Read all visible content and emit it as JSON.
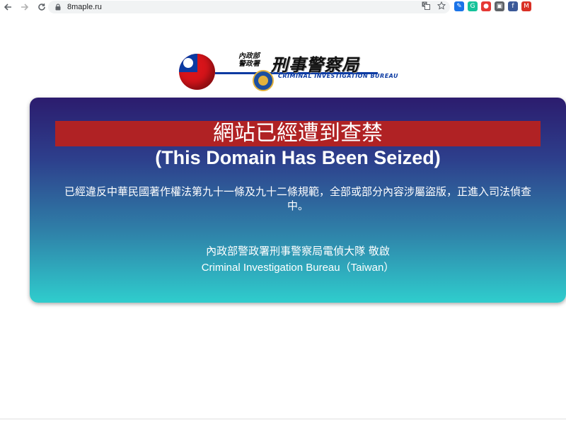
{
  "browser": {
    "url": "8maple.ru",
    "back_icon": "arrow-left-icon",
    "forward_icon": "arrow-right-icon",
    "reload_icon": "reload-icon",
    "lock_icon": "lock-icon",
    "translate_icon": "translate-icon",
    "bookmark_icon": "star-icon",
    "extensions": [
      {
        "name": "pen-extension-icon",
        "color": "#1a73e8",
        "glyph": "✎"
      },
      {
        "name": "grammarly-extension-icon",
        "color": "#15c39a",
        "glyph": "G"
      },
      {
        "name": "red-extension-icon",
        "color": "#e53935",
        "glyph": "●"
      },
      {
        "name": "gray-extension-icon",
        "color": "#5f6368",
        "glyph": "▣"
      },
      {
        "name": "facebook-extension-icon",
        "color": "#3b5998",
        "glyph": "f"
      },
      {
        "name": "gmail-extension-icon",
        "color": "#d93025",
        "glyph": "M"
      }
    ]
  },
  "logo": {
    "agency_line1": "內政部",
    "agency_line2": "警政署",
    "title": "刑事警察局",
    "subtitle": "CRIMINAL INVESTIGATION BUREAU"
  },
  "seizure": {
    "banner_title": "網站已經遭到查禁",
    "headline": "(This Domain Has Been Seized)",
    "notice": "已經違反中華民國著作權法第九十一條及九十二條規範，全部或部分內容涉屬盜版，正進入司法偵查中。",
    "signature_cn": "內政部警政署刑事警察局電偵大隊 敬啟",
    "signature_en": "Criminal Investigation Bureau（Taiwan）"
  },
  "colors": {
    "banner": "#b02224",
    "gradient_top": "#2c1c6e",
    "gradient_bottom": "#2fcdcd",
    "flag_red": "#d7141a",
    "flag_blue": "#0b3aa2"
  }
}
